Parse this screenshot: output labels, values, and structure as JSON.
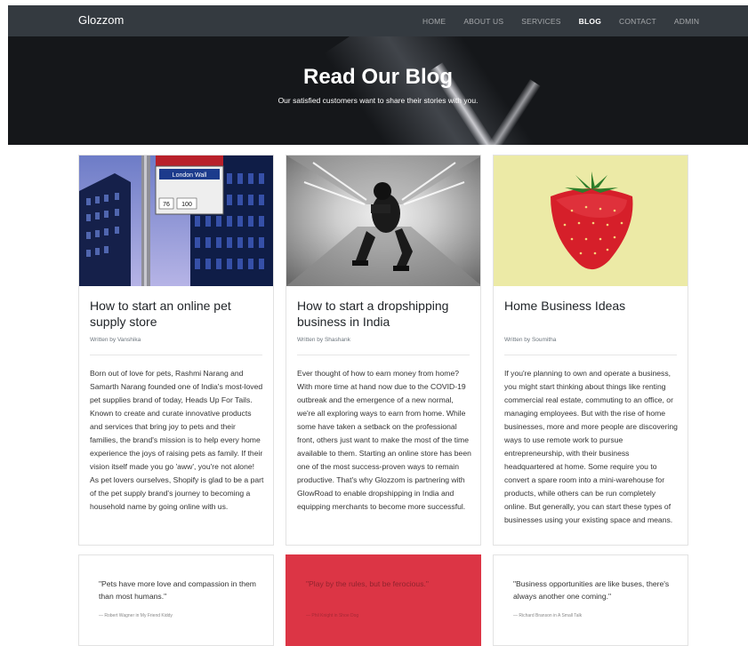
{
  "navbar": {
    "brand": "Glozzom",
    "links": [
      {
        "label": "HOME"
      },
      {
        "label": "ABOUT US"
      },
      {
        "label": "SERVICES"
      },
      {
        "label": "BLOG"
      },
      {
        "label": "CONTACT"
      },
      {
        "label": "ADMIN"
      }
    ],
    "active": "BLOG"
  },
  "hero": {
    "title": "Read Our Blog",
    "subtitle": "Our satisfied customers want to share their stories with you."
  },
  "posts": [
    {
      "title": "How to start an online pet supply store",
      "author": "Written by Vanshika",
      "body": "Born out of love for pets, Rashmi Narang and Samarth Narang founded one of India's most-loved pet supplies brand of today, Heads Up For Tails. Known to create and curate innovative products and services that bring joy to pets and their families, the brand's mission is to help every home experience the joys of raising pets as family. If their vision itself made you go 'aww', you're not alone! As pet lovers ourselves, Shopify is glad to be a part of the pet supply brand's journey to becoming a household name by going online with us.",
      "sign": {
        "line1": "London Wall",
        "line2": "76",
        "line3": "100"
      }
    },
    {
      "title": "How to start a dropshipping business in India",
      "author": "Written by Shashank",
      "body": "Ever thought of how to earn money from home? With more time at hand now due to the COVID-19 outbreak and the emergence of a new normal, we're all exploring ways to earn from home. While some have taken a setback on the professional front, others just want to make the most of the time available to them. Starting an online store has been one of the most success-proven ways to remain productive. That's why Glozzom is partnering with GlowRoad to enable dropshipping in India and equipping merchants to become more successful."
    },
    {
      "title": "Home Business Ideas",
      "author": "Written by Soumitha",
      "body": "If you're planning to own and operate a business, you might start thinking about things like renting commercial real estate, commuting to an office, or managing employees. But with the rise of home businesses, more and more people are discovering ways to use remote work to pursue entrepreneurship, with their business headquartered at home. Some require you to convert a spare room into a mini-warehouse for products, while others can be run completely online. But generally, you can start these types of businesses using your existing space and means."
    }
  ],
  "quotes": [
    {
      "text": "\"Pets have more love and compassion in them than most humans.\"",
      "cite": "— Robert Wagner in My Friend Kiddy"
    },
    {
      "text": "\"Play by the rules, but be ferocious.\"",
      "cite": "— Phil Knight in Shoe Dog"
    },
    {
      "text": "\"Business opportunities are like buses, there's always another one coming.\"",
      "cite": "— Richard Branson in A Small Talk"
    }
  ],
  "colors": {
    "navbar": "#343a40",
    "quote_accent": "#dc3545",
    "strawberry_bg": "#eceaa6"
  }
}
